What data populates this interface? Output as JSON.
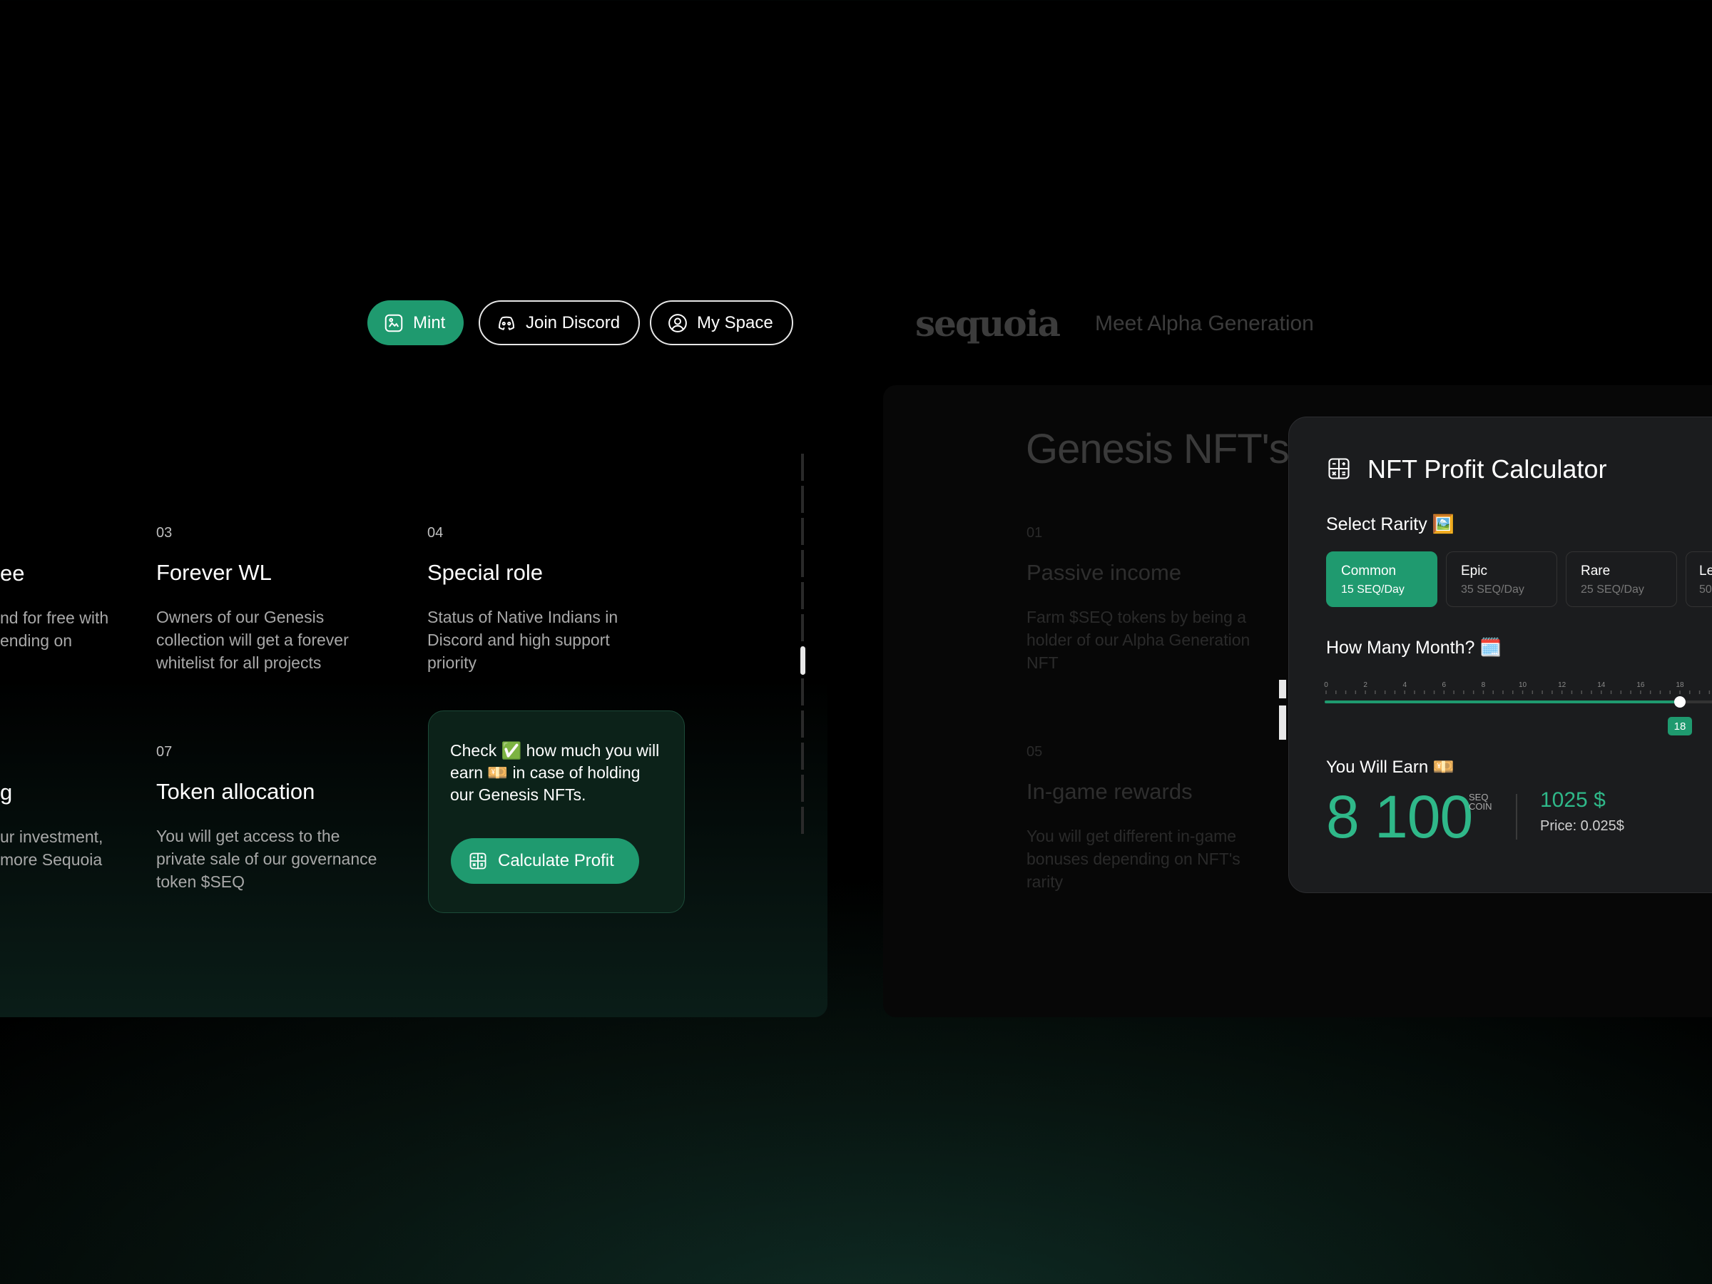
{
  "nav": {
    "mint": "Mint",
    "discord": "Join Discord",
    "myspace": "My Space"
  },
  "brand": {
    "logo_text": "sequoia",
    "tagline": "Meet Alpha Generation"
  },
  "left_features": [
    {
      "num": "",
      "title": "ee",
      "desc": "nd for free with\nending on"
    },
    {
      "num": "03",
      "title": "Forever WL",
      "desc": "Owners of our Genesis collection will get a forever whitelist for all projects"
    },
    {
      "num": "04",
      "title": "Special role",
      "desc": "Status of Native Indians in Discord and high support priority"
    },
    {
      "num": "",
      "title": "g",
      "desc": "ur investment,\nmore Sequoia"
    },
    {
      "num": "07",
      "title": "Token allocation",
      "desc": "You will get access to the private sale of our governance token $SEQ"
    }
  ],
  "check_card": {
    "text": "Check ✅ how much you will earn 💴 in case of holding our Genesis NFTs.",
    "button": "Calculate Profit"
  },
  "right_panel": {
    "heading": "Genesis NFT's",
    "features": [
      {
        "num": "01",
        "title": "Passive income",
        "desc": "Farm $SEQ tokens by being a holder of our Alpha Generation NFT"
      },
      {
        "num": "05",
        "title": "In-game rewards",
        "desc": "You will get different in-game bonuses depending on NFT's rarity"
      }
    ]
  },
  "calculator": {
    "title": "NFT Profit Calculator",
    "select_rarity": "Select Rarity 🖼️",
    "rarities": [
      {
        "name": "Common",
        "rate": "15 SEQ/Day",
        "active": true
      },
      {
        "name": "Epic",
        "rate": "35 SEQ/Day",
        "active": false
      },
      {
        "name": "Rare",
        "rate": "25 SEQ/Day",
        "active": false
      },
      {
        "name": "Le",
        "rate": "50",
        "active": false
      }
    ],
    "months_label": "How Many Month? 🗓️",
    "slider": {
      "ticks": [
        "0",
        "2",
        "4",
        "6",
        "8",
        "10",
        "12",
        "14",
        "16",
        "18"
      ],
      "min": 0,
      "max": 18,
      "value": 18,
      "value_label": "18"
    },
    "earn_label": "You Will Earn 💴",
    "earn_amount": "8 100",
    "unit_line1": "SEQ",
    "unit_line2": "COIN",
    "usd_value": "1025 $",
    "price": "Price: 0.025$"
  },
  "colors": {
    "accent": "#1f9a6f",
    "accent_text": "#2fb889",
    "calc_bg": "#1b1c1e"
  }
}
